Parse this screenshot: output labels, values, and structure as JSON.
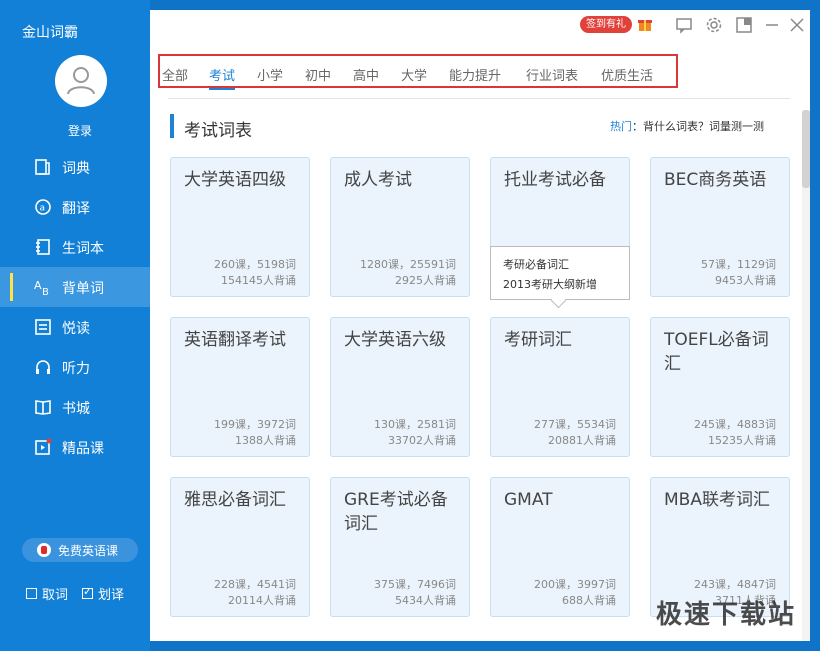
{
  "app": {
    "title": "金山词霸"
  },
  "user": {
    "login_label": "登录"
  },
  "sidebar": {
    "items": [
      {
        "label": "词典",
        "icon": "dictionary-icon"
      },
      {
        "label": "翻译",
        "icon": "translate-icon"
      },
      {
        "label": "生词本",
        "icon": "wordbook-icon"
      },
      {
        "label": "背单词",
        "icon": "recite-words-icon",
        "active": true
      },
      {
        "label": "悦读",
        "icon": "reading-icon"
      },
      {
        "label": "听力",
        "icon": "headphones-icon"
      },
      {
        "label": "书城",
        "icon": "book-icon"
      },
      {
        "label": "精品课",
        "icon": "course-icon"
      }
    ],
    "free_course_label": "免费英语课",
    "check_capture": {
      "label": "取词",
      "checked": false
    },
    "check_translate": {
      "label": "划译",
      "checked": true
    }
  },
  "topbar": {
    "signin_label": "签到有礼"
  },
  "tabs": [
    {
      "label": "全部"
    },
    {
      "label": "考试",
      "active": true
    },
    {
      "label": "小学"
    },
    {
      "label": "初中"
    },
    {
      "label": "高中"
    },
    {
      "label": "大学"
    },
    {
      "label": "能力提升"
    },
    {
      "label": "行业词表"
    },
    {
      "label": "优质生活"
    }
  ],
  "section": {
    "title": "考试词表",
    "hot_label": "热门",
    "hot_links": "：背什么词表？词量测一测"
  },
  "cards": [
    {
      "title": "大学英语四级",
      "lessons": "260课，5198词",
      "readers": "154145人背诵"
    },
    {
      "title": "成人考试",
      "lessons": "1280课，25591词",
      "readers": "2925人背诵"
    },
    {
      "title": "托业考试必备",
      "lessons": "",
      "readers": ""
    },
    {
      "title": "BEC商务英语",
      "lessons": "57课，1129词",
      "readers": "9453人背诵"
    },
    {
      "title": "英语翻译考试",
      "lessons": "199课，3972词",
      "readers": "1388人背诵"
    },
    {
      "title": "大学英语六级",
      "lessons": "130课，2581词",
      "readers": "33702人背诵"
    },
    {
      "title": "考研词汇",
      "lessons": "277课，5534词",
      "readers": "20881人背诵"
    },
    {
      "title": "TOEFL必备词汇",
      "lessons": "245课，4883词",
      "readers": "15235人背诵"
    },
    {
      "title": "雅思必备词汇",
      "lessons": "228课，4541词",
      "readers": "20114人背诵"
    },
    {
      "title": "GRE考试必备词汇",
      "lessons": "375课，7496词",
      "readers": "5434人背诵"
    },
    {
      "title": "GMAT",
      "lessons": "200课，3997词",
      "readers": "688人背诵"
    },
    {
      "title": "MBA联考词汇",
      "lessons": "243课，4847词",
      "readers": "3711人背诵"
    }
  ],
  "tooltip": {
    "line1": "考研必备词汇",
    "line2": "2013考研大纲新增"
  },
  "watermark": "极速下载站",
  "colors": {
    "sidebar": "#1280d6",
    "accent": "#1e82d6",
    "highlight_box": "#d9363a",
    "signin_badge": "#e0413a"
  }
}
